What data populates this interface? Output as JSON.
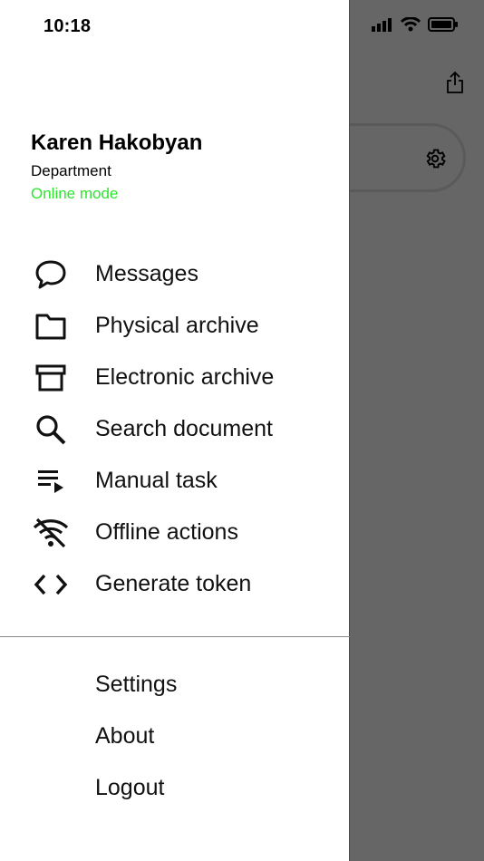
{
  "status_bar": {
    "time": "10:18",
    "icons": [
      "signal-icon",
      "wifi-icon",
      "battery-icon"
    ]
  },
  "user": {
    "name": "Karen Hakobyan",
    "department": "Department",
    "mode": "Online mode"
  },
  "menu": {
    "items": [
      {
        "label": "Messages",
        "icon": "chat-bubble-icon"
      },
      {
        "label": "Physical archive",
        "icon": "folder-icon"
      },
      {
        "label": "Electronic archive",
        "icon": "archive-box-icon"
      },
      {
        "label": "Search document",
        "icon": "search-icon"
      },
      {
        "label": "Manual task",
        "icon": "playlist-play-icon"
      },
      {
        "label": "Offline actions",
        "icon": "wifi-off-icon"
      },
      {
        "label": "Generate token",
        "icon": "code-brackets-icon"
      }
    ]
  },
  "bottom_menu": {
    "items": [
      {
        "label": "Settings"
      },
      {
        "label": "About"
      },
      {
        "label": "Logout"
      }
    ]
  },
  "colors": {
    "online": "#2ee52e",
    "backdrop": "#666666",
    "drawer": "#ffffff"
  }
}
